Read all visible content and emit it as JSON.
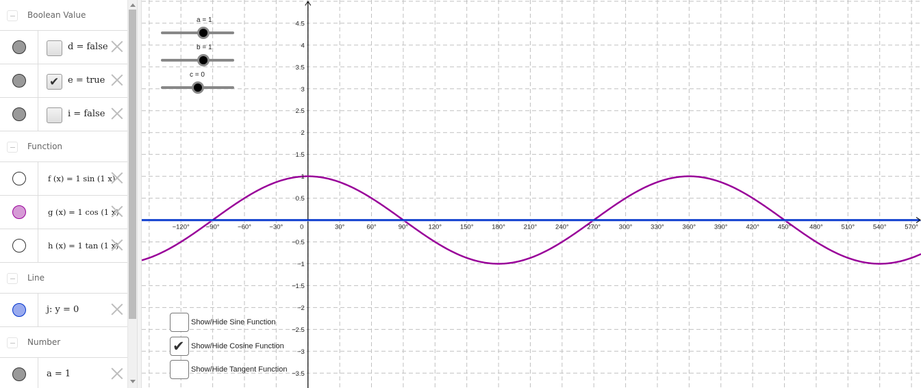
{
  "sidebar": {
    "groups": [
      {
        "title": "Boolean Value",
        "items": [
          {
            "label": "d = false",
            "checked": false,
            "marble": "#999999"
          },
          {
            "label": "e = true",
            "checked": true,
            "marble": "#999999"
          },
          {
            "label": "i = false",
            "checked": false,
            "marble": "#999999"
          }
        ]
      },
      {
        "title": "Function",
        "items": [
          {
            "label": "f (x)  =  1  sin (1 x)",
            "marble": "#ffffff"
          },
          {
            "label": "g (x)  =  1  cos (1 x)",
            "marble": "#d69bd6"
          },
          {
            "label": "h (x)  =  1  tan (1 x)",
            "marble": "#ffffff"
          }
        ]
      },
      {
        "title": "Line",
        "items": [
          {
            "label": "j: y = 0",
            "marble": "#99aaee"
          }
        ]
      },
      {
        "title": "Number",
        "items": [
          {
            "label": "a = 1",
            "marble": "#999999"
          }
        ]
      }
    ]
  },
  "sliders": [
    {
      "label": "a = 1",
      "value": 1,
      "min": -5,
      "max": 5
    },
    {
      "label": "b = 1",
      "value": 1,
      "min": -5,
      "max": 5
    },
    {
      "label": "c = 0",
      "value": 0,
      "min": -3,
      "max": 3
    }
  ],
  "checkboxes": [
    {
      "label": "Show/Hide Sine Function",
      "checked": false
    },
    {
      "label": "Show/Hide Cosine Function",
      "checked": true
    },
    {
      "label": "Show/Hide Tangent Function",
      "checked": false
    }
  ],
  "colors": {
    "curve": "#990099",
    "line_j": "#0033cc",
    "axis": "#000000",
    "grid": "#c0c0c0"
  },
  "chart_data": {
    "type": "line",
    "title": "",
    "xlabel": "",
    "ylabel": "",
    "x_unit": "degrees",
    "xlim": [
      -157,
      579
    ],
    "ylim": [
      -3.84,
      5.03
    ],
    "x_ticks": [
      -120,
      -90,
      -60,
      -30,
      0,
      30,
      60,
      90,
      120,
      150,
      180,
      210,
      240,
      270,
      300,
      330,
      360,
      390,
      420,
      450,
      480,
      510,
      540,
      570
    ],
    "x_tick_labels": [
      "−120°",
      "−90°",
      "−60°",
      "−30°",
      "0",
      "30°",
      "60°",
      "90°",
      "120°",
      "150°",
      "180°",
      "210°",
      "240°",
      "270°",
      "300°",
      "330°",
      "360°",
      "390°",
      "420°",
      "450°",
      "480°",
      "510°",
      "540°",
      "570°"
    ],
    "y_ticks": [
      -3.5,
      -3,
      -2.5,
      -2,
      -1.5,
      -1,
      -0.5,
      0.5,
      1,
      1.5,
      2,
      2.5,
      3,
      3.5,
      4,
      4.5
    ],
    "y_tick_labels": [
      "−3.5",
      "−3",
      "−2.5",
      "−2",
      "−1.5",
      "−1",
      "−0.5",
      "0.5",
      "1",
      "1.5",
      "2",
      "2.5",
      "3",
      "3.5",
      "4",
      "4.5"
    ],
    "grid": true,
    "series": [
      {
        "name": "g(x) = 1 cos(1x)",
        "function": "cos",
        "amplitude": 1,
        "frequency": 1,
        "x": [
          -150,
          -120,
          -90,
          -60,
          -30,
          0,
          30,
          60,
          90,
          120,
          150,
          180,
          210,
          240,
          270,
          300,
          330,
          360,
          390,
          420,
          450,
          480,
          510,
          540,
          570
        ],
        "values": [
          -0.866,
          -0.5,
          0,
          0.5,
          0.866,
          1,
          0.866,
          0.5,
          0,
          -0.5,
          -0.866,
          -1,
          -0.866,
          -0.5,
          0,
          0.5,
          0.866,
          1,
          0.866,
          0.5,
          0,
          -0.5,
          -0.866,
          -1,
          -0.866
        ]
      },
      {
        "name": "j: y = 0",
        "function": "constant",
        "values": [
          0
        ]
      }
    ]
  }
}
